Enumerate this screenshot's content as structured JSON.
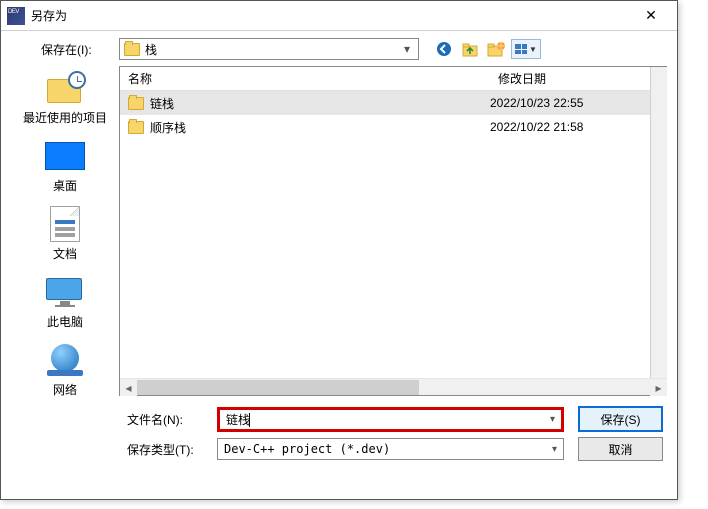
{
  "window": {
    "title": "另存为"
  },
  "location": {
    "label": "保存在(I):",
    "current": "栈"
  },
  "places": {
    "recent": "最近使用的项目",
    "desktop": "桌面",
    "documents": "文档",
    "this_pc": "此电脑",
    "network": "网络"
  },
  "columns": {
    "name": "名称",
    "modified": "修改日期"
  },
  "files": [
    {
      "name": "链栈",
      "date": "2022/10/23 22:55",
      "selected": true
    },
    {
      "name": "顺序栈",
      "date": "2022/10/22 21:58",
      "selected": false
    }
  ],
  "filename": {
    "label": "文件名(N):",
    "value": "链栈"
  },
  "filetype": {
    "label": "保存类型(T):",
    "value": "Dev-C++ project (*.dev)"
  },
  "buttons": {
    "save": "保存(S)",
    "cancel": "取消"
  }
}
